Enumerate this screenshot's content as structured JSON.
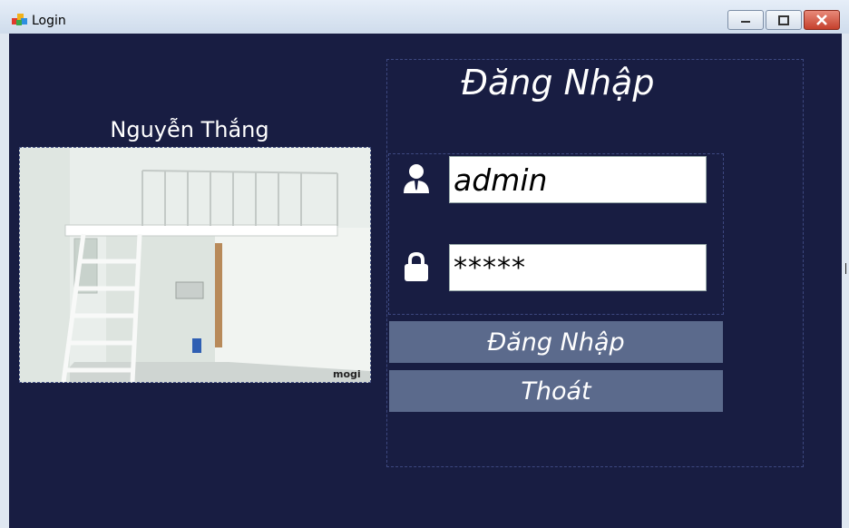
{
  "window": {
    "title": "Login"
  },
  "left": {
    "caption": "Nguyễn Thắng",
    "photo_watermark": "mogi"
  },
  "login": {
    "title": "Đăng Nhập",
    "username_value": "admin",
    "password_value": "*****",
    "login_button": "Đăng Nhập",
    "exit_button": "Thoát"
  },
  "icons": [
    "app-icon",
    "minimize-icon",
    "maximize-icon",
    "close-icon",
    "user-icon",
    "lock-icon"
  ],
  "colors": {
    "background": "#181d42",
    "button": "#5b6a8c",
    "close": "#c5402c"
  }
}
